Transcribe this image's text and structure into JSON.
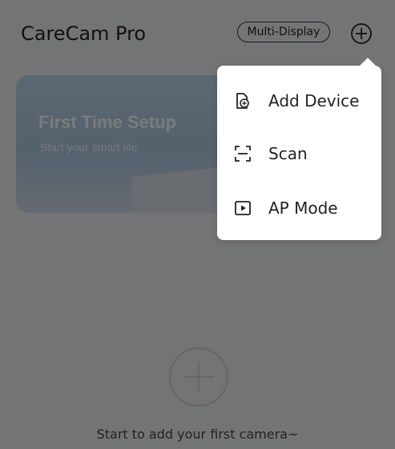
{
  "header": {
    "title": "CareCam Pro",
    "multi_display_label": "Multi-Display",
    "add_icon": "plus-circle-icon"
  },
  "banner": {
    "title": "First Time Setup",
    "subtitle": "Start your smart life"
  },
  "empty_state": {
    "add_icon": "plus-circle-icon",
    "message": "Start to add your first camera~"
  },
  "menu": {
    "items": [
      {
        "label": "Add Device",
        "icon": "add-device-icon"
      },
      {
        "label": "Scan",
        "icon": "scan-icon"
      },
      {
        "label": "AP Mode",
        "icon": "play-box-icon"
      }
    ]
  },
  "colors": {
    "overlay": "#00000080",
    "menu_bg": "#ffffff",
    "banner": "#b7cfe3"
  }
}
